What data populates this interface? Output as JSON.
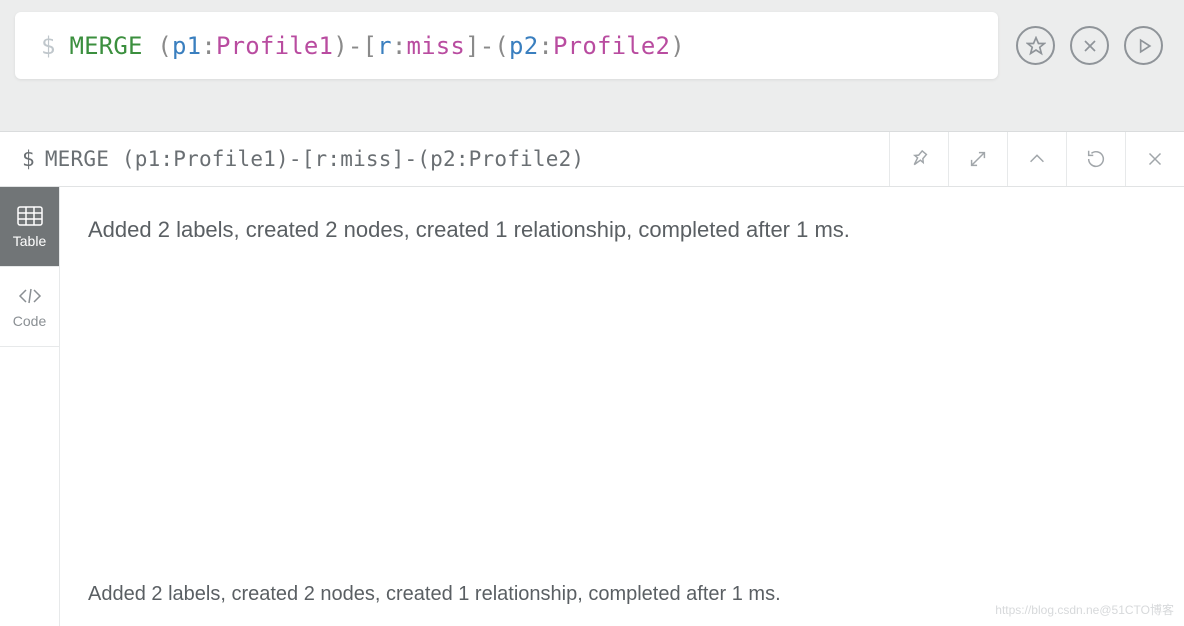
{
  "editor": {
    "prompt": "$",
    "tokens": [
      {
        "t": "MERGE",
        "c": "keyword"
      },
      {
        "t": " ",
        "c": "space"
      },
      {
        "t": "(",
        "c": "punc"
      },
      {
        "t": "p1",
        "c": "var"
      },
      {
        "t": ":",
        "c": "punc"
      },
      {
        "t": "Profile1",
        "c": "label"
      },
      {
        "t": ")",
        "c": "punc"
      },
      {
        "t": "-",
        "c": "punc"
      },
      {
        "t": "[",
        "c": "punc"
      },
      {
        "t": "r",
        "c": "var"
      },
      {
        "t": ":",
        "c": "punc"
      },
      {
        "t": "miss",
        "c": "rel"
      },
      {
        "t": "]",
        "c": "punc"
      },
      {
        "t": "-",
        "c": "punc"
      },
      {
        "t": "(",
        "c": "punc"
      },
      {
        "t": "p2",
        "c": "var"
      },
      {
        "t": ":",
        "c": "punc"
      },
      {
        "t": "Profile2",
        "c": "label"
      },
      {
        "t": ")",
        "c": "punc"
      }
    ]
  },
  "top_buttons": {
    "favorite": "favorite",
    "clear": "clear",
    "run": "run"
  },
  "result": {
    "query_prompt": "$",
    "query_text": "MERGE (p1:Profile1)-[r:miss]-(p2:Profile2)",
    "status": "Added 2 labels, created 2 nodes, created 1 relationship, completed after 1 ms.",
    "footer": "Added 2 labels, created 2 nodes, created 1 relationship, completed after 1 ms."
  },
  "result_actions": {
    "pin": "pin",
    "expand": "expand",
    "collapse": "collapse",
    "rerun": "rerun",
    "close": "close"
  },
  "view_tabs": {
    "table": "Table",
    "code": "Code"
  },
  "watermark": "https://blog.csdn.ne@51CTO博客"
}
